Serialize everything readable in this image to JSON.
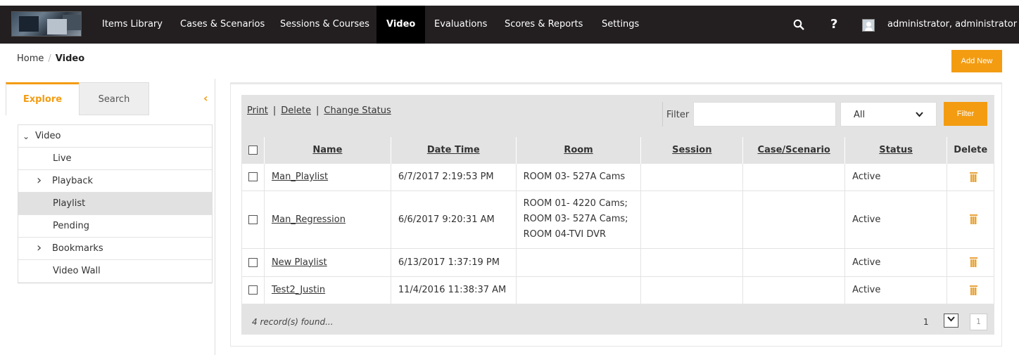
{
  "nav": {
    "items": [
      "Items Library",
      "Cases & Scenarios",
      "Sessions & Courses",
      "Video",
      "Evaluations",
      "Scores & Reports",
      "Settings"
    ],
    "active": "Video",
    "search_icon": "search-icon",
    "help_label": "?",
    "user_name": "administrator, administrator"
  },
  "breadcrumb": {
    "home": "Home",
    "separator": "/",
    "current": "Video"
  },
  "actions": {
    "add_new": "Add New"
  },
  "left_panel": {
    "tabs": [
      "Explore",
      "Search"
    ],
    "active_tab": "Explore",
    "tree": [
      {
        "label": "Video",
        "expander": "⌄",
        "level": 0
      },
      {
        "label": "Live",
        "expander": "",
        "level": 1
      },
      {
        "label": "Playback",
        "expander": "›",
        "level": 1
      },
      {
        "label": "Playlist",
        "expander": "",
        "level": 1,
        "selected": true
      },
      {
        "label": "Pending",
        "expander": "",
        "level": 1
      },
      {
        "label": "Bookmarks",
        "expander": "›",
        "level": 1
      },
      {
        "label": "Video Wall",
        "expander": "",
        "level": 1
      }
    ]
  },
  "toolbar": {
    "print": "Print",
    "delete": "Delete",
    "change_status": "Change Status",
    "separator": "|",
    "filter_label": "Filter",
    "filter_value": "",
    "status_select": "All",
    "filter_button": "Filter"
  },
  "grid": {
    "columns": [
      "Name",
      "Date Time",
      "Room",
      "Session",
      "Case/Scenario",
      "Status",
      "Delete"
    ],
    "rows": [
      {
        "name": "Man_Playlist",
        "datetime": "6/7/2017 2:19:53 PM",
        "room": "ROOM 03- 527A Cams",
        "session": "",
        "case": "",
        "status": "Active"
      },
      {
        "name": "Man_Regression",
        "datetime": "6/6/2017 9:20:31 AM",
        "room": "ROOM 01- 4220 Cams;\nROOM 03- 527A Cams;\nROOM 04-TVI DVR",
        "session": "",
        "case": "",
        "status": "Active"
      },
      {
        "name": "New Playlist",
        "datetime": "6/13/2017 1:37:19 PM",
        "room": "",
        "session": "",
        "case": "",
        "status": "Active"
      },
      {
        "name": "Test2_Justin",
        "datetime": "11/4/2016 11:38:37 AM",
        "room": "",
        "session": "",
        "case": "",
        "status": "Active"
      }
    ],
    "records_found": "4 record(s) found...",
    "page": "1",
    "total_pages": "1"
  },
  "colors": {
    "accent": "#f39c12",
    "nav_bg": "#231f20",
    "grid_header": "#e3e3e3"
  }
}
